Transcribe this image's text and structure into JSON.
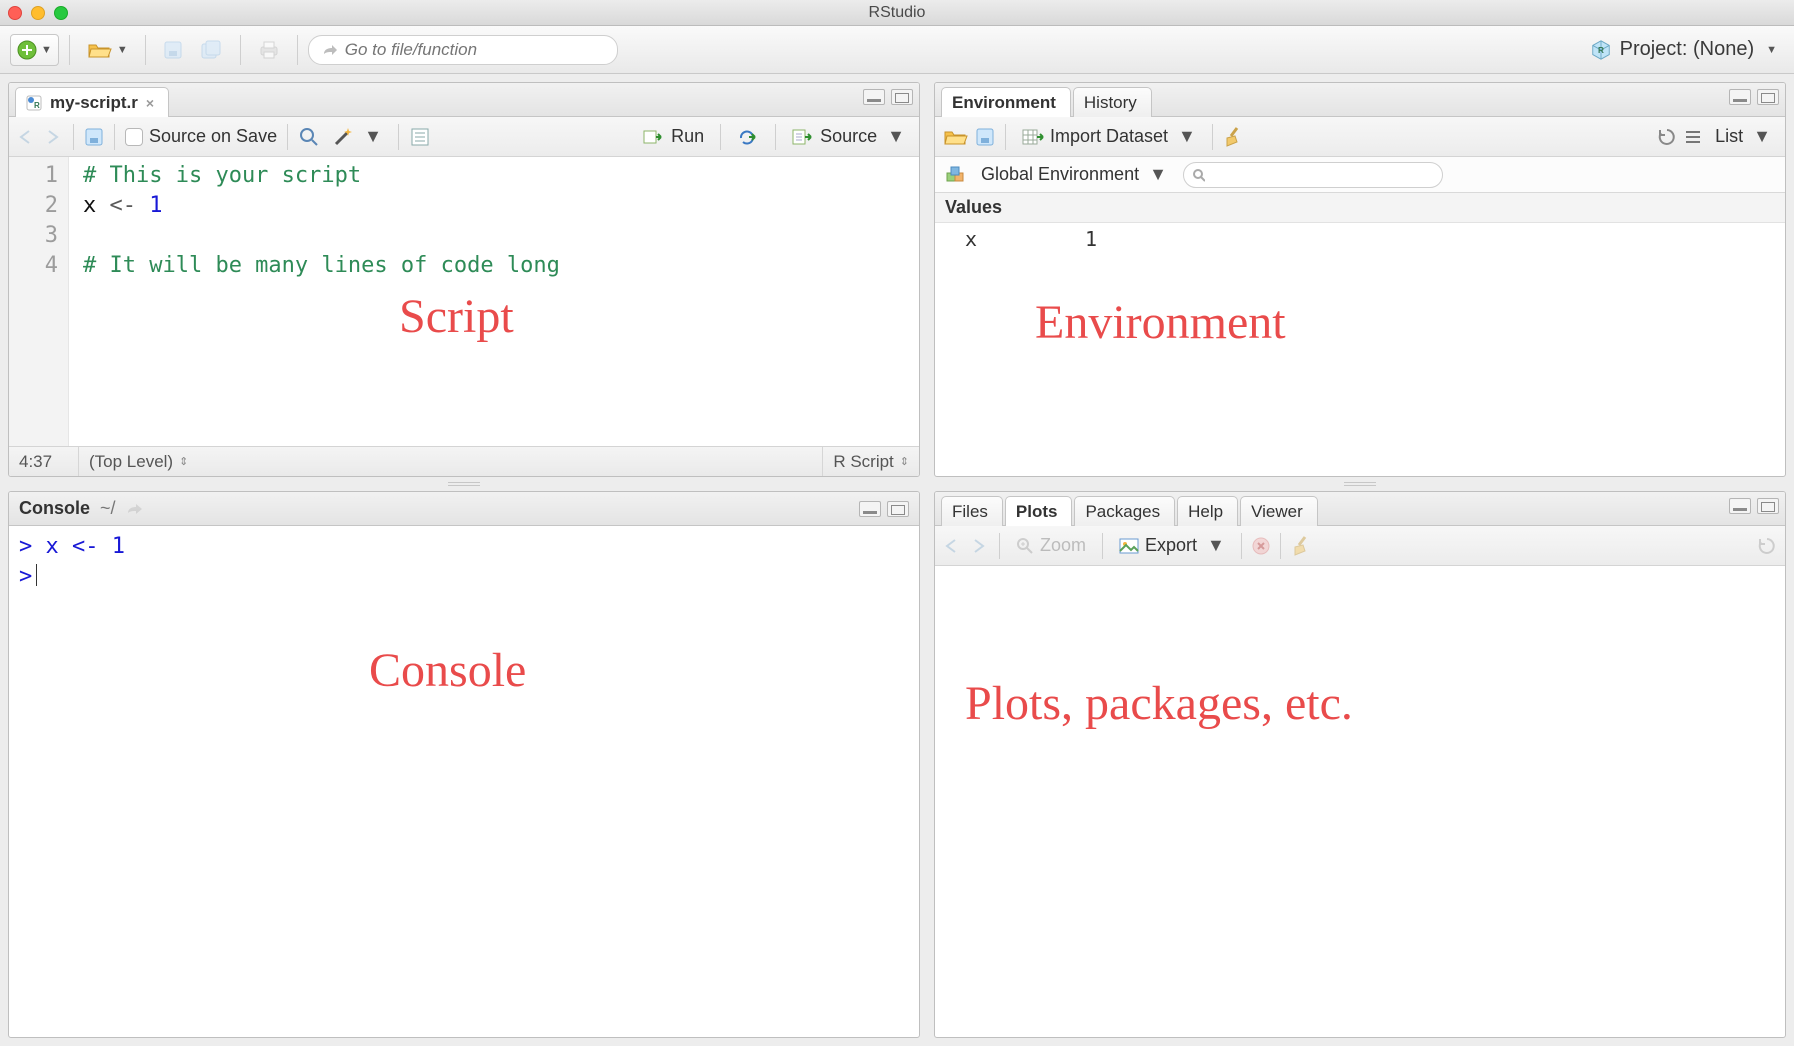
{
  "window": {
    "title": "RStudio"
  },
  "main_toolbar": {
    "goto_placeholder": "Go to file/function",
    "project_label": "Project: (None)"
  },
  "source": {
    "tab_name": "my-script.r",
    "source_on_save": "Source on Save",
    "run": "Run",
    "source_btn": "Source",
    "lines": {
      "l1_comment": "# This is your script",
      "l2_ident": "x",
      "l2_assign": " <- ",
      "l2_num": "1",
      "l4_comment": "# It will be many lines of code long"
    },
    "gutter": {
      "n1": "1",
      "n2": "2",
      "n3": "3",
      "n4": "4"
    },
    "status": {
      "pos": "4:37",
      "scope": "(Top Level)",
      "lang": "R Script"
    },
    "annotation": "Script"
  },
  "console": {
    "title": "Console",
    "path": "~/",
    "line1": "> x <- 1",
    "prompt": ">",
    "annotation": "Console"
  },
  "environment": {
    "tabs": {
      "env": "Environment",
      "history": "History"
    },
    "import": "Import Dataset",
    "list": "List",
    "scope": "Global Environment",
    "section": "Values",
    "row": {
      "name": "x",
      "value": "1"
    },
    "annotation": "Environment"
  },
  "plots": {
    "tabs": {
      "files": "Files",
      "plots": "Plots",
      "packages": "Packages",
      "help": "Help",
      "viewer": "Viewer"
    },
    "zoom": "Zoom",
    "export": "Export",
    "annotation": "Plots, packages, etc."
  }
}
